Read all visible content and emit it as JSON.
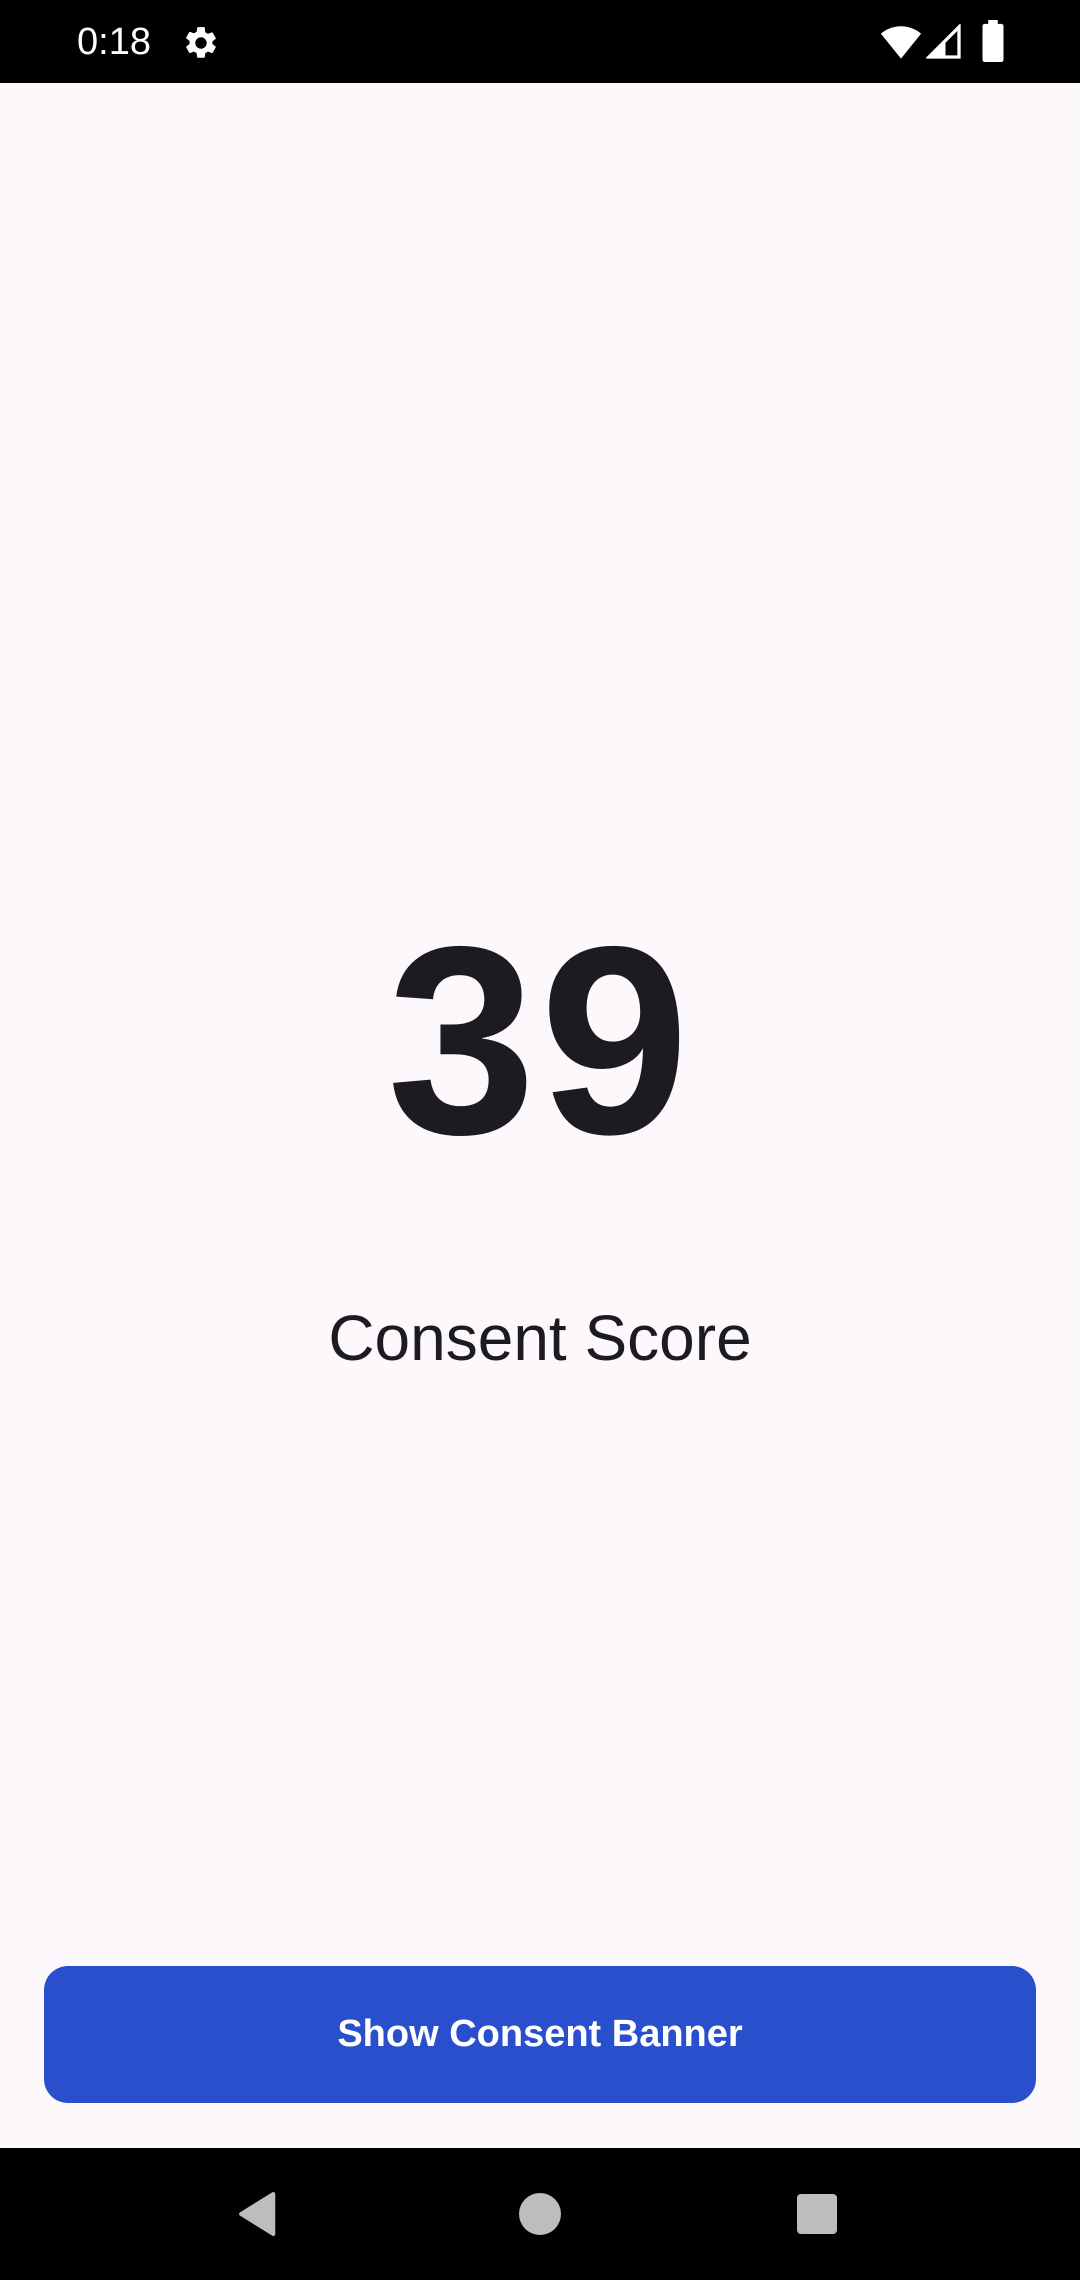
{
  "status_bar": {
    "time": "0:18",
    "icons": [
      "gear-icon",
      "wifi-icon",
      "cellular-signal-icon",
      "battery-icon"
    ]
  },
  "main": {
    "score_value": "39",
    "score_label": "Consent Score"
  },
  "actions": {
    "consent_button_label": "Show Consent Banner"
  },
  "navigation": {
    "buttons": [
      "back-icon",
      "home-icon",
      "recents-icon"
    ]
  },
  "colors": {
    "background": "#fdf8fc",
    "text_primary": "#1c1b1f",
    "accent": "#2a4fcd",
    "system_bars": "#000000"
  }
}
